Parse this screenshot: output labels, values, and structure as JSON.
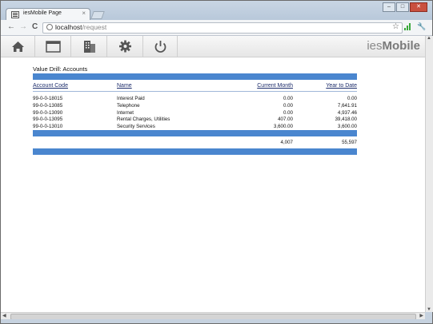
{
  "browser": {
    "tab_title": "iesMobile Page",
    "tab_close": "×",
    "url_host": "localhost",
    "url_path": "/request",
    "back": "←",
    "forward": "→",
    "reload": "C",
    "star": "☆",
    "wrench": "🔧",
    "win_min": "–",
    "win_max": "□",
    "win_close": "✕"
  },
  "app": {
    "brand_prefix": "ies",
    "brand_suffix": "Mobile",
    "toolbar": [
      "home-icon",
      "window-icon",
      "building-icon",
      "gear-icon",
      "power-icon"
    ]
  },
  "report": {
    "title": "Value Drill: Accounts",
    "headers": {
      "code": "Account Code",
      "name": "Name",
      "current": "Current Month",
      "ytd": "Year to Date"
    },
    "rows": [
      {
        "code": "99-0-0-18015",
        "name": "Interest Paid",
        "current": "0.00",
        "ytd": "0.00"
      },
      {
        "code": "99-0-0-13085",
        "name": "Telephone",
        "current": "0.00",
        "ytd": "7,641.91"
      },
      {
        "code": "99-0-0-13090",
        "name": "Internet",
        "current": "0.00",
        "ytd": "4,937.46"
      },
      {
        "code": "99-0-0-13095",
        "name": "Rental Charges, Utilities",
        "current": "407.00",
        "ytd": "39,418.00"
      },
      {
        "code": "99-0-0-13010",
        "name": "Security Services",
        "current": "3,600.00",
        "ytd": "3,600.00"
      }
    ],
    "totals": {
      "current": "4,007",
      "ytd": "55,597"
    }
  },
  "colors": {
    "accent": "#4a86cf",
    "header_text": "#1d2d6b"
  }
}
